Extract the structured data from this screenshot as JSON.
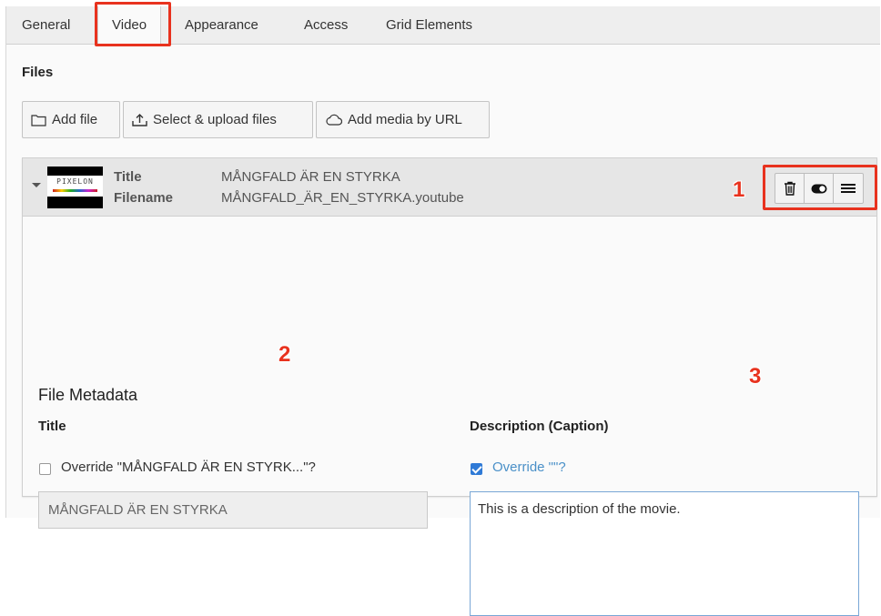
{
  "tabs": [
    {
      "label": "General"
    },
    {
      "label": "Video"
    },
    {
      "label": "Appearance"
    },
    {
      "label": "Access"
    },
    {
      "label": "Grid Elements"
    }
  ],
  "files": {
    "section_title": "Files",
    "buttons": {
      "add_file": "Add file",
      "select_upload": "Select & upload files",
      "add_media_url": "Add media by URL"
    }
  },
  "file_item": {
    "thumbnail_text": "PIXELON",
    "title_label": "Title",
    "title_value": "MÅNGFALD ÄR EN STYRKA",
    "filename_label": "Filename",
    "filename_value": "MÅNGFALD_ÄR_EN_STYRKA.youtube",
    "controls": [
      "trash-icon",
      "toggle-visibility-icon",
      "drag-handle-icon"
    ]
  },
  "metadata": {
    "heading": "File Metadata",
    "title_field": {
      "label": "Title",
      "override_label": "Override \"MÅNGFALD ÄR EN STYRK...\"?",
      "override_checked": false,
      "value": "MÅNGFALD ÄR EN STYRKA"
    },
    "description_field": {
      "label": "Description (Caption)",
      "override_label": "Override \"\"?",
      "override_checked": true,
      "value": "This is a description of the movie."
    }
  },
  "annotations": {
    "one": "1",
    "two": "2",
    "three": "3"
  },
  "colors": {
    "annotation_red": "#e8321e",
    "checkbox_blue": "#2f7ad6",
    "override_link_blue": "#4a90c8"
  }
}
